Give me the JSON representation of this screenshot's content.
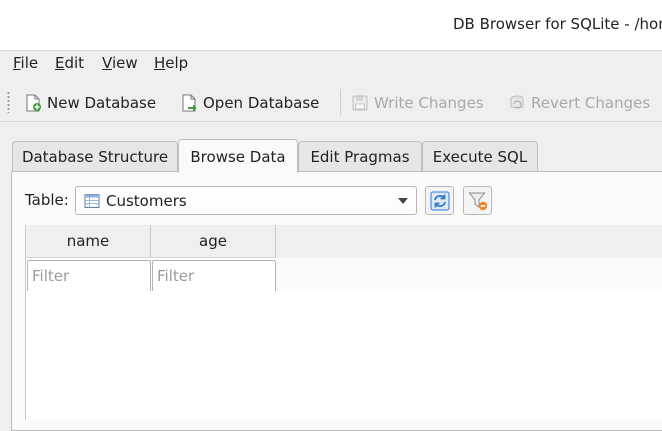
{
  "window": {
    "title": "DB Browser for SQLite - /home"
  },
  "menubar": {
    "items": [
      {
        "label": "File"
      },
      {
        "label": "Edit"
      },
      {
        "label": "View"
      },
      {
        "label": "Help"
      }
    ]
  },
  "toolbar": {
    "new_database": "New Database",
    "open_database": "Open Database",
    "write_changes": "Write Changes",
    "revert_changes": "Revert Changes"
  },
  "tabs": [
    {
      "label": "Database Structure"
    },
    {
      "label": "Browse Data",
      "active": true
    },
    {
      "label": "Edit Pragmas"
    },
    {
      "label": "Execute SQL"
    }
  ],
  "browse": {
    "table_label": "Table:",
    "selected_table": "Customers",
    "columns": [
      {
        "header": "name",
        "filter_placeholder": "Filter"
      },
      {
        "header": "age",
        "filter_placeholder": "Filter"
      }
    ]
  },
  "colors": {
    "window_bg": "#efefef",
    "pane_bg": "#fafafa",
    "disabled_text": "#a9a9a9",
    "accent_blue": "#2f7bd6"
  }
}
